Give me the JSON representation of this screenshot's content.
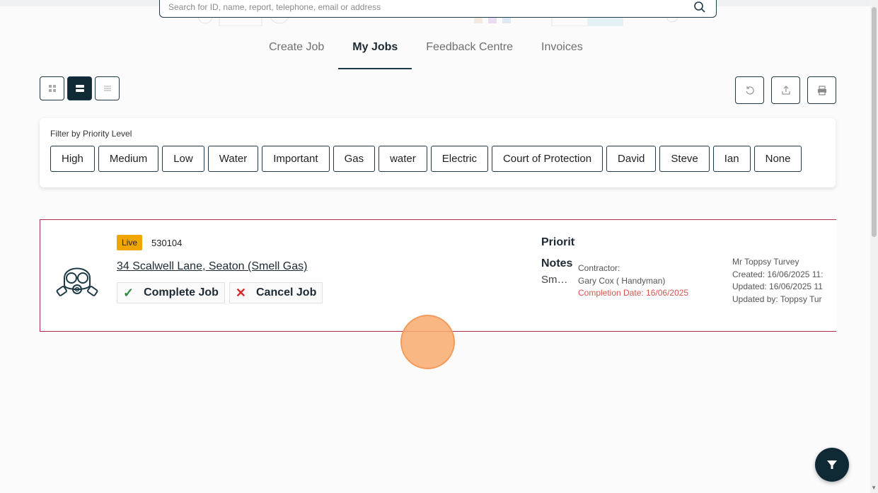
{
  "search": {
    "placeholder": "Search for ID, name, report, telephone, email or address"
  },
  "tabs": [
    {
      "label": "Create Job",
      "active": false
    },
    {
      "label": "My Jobs",
      "active": true
    },
    {
      "label": "Feedback Centre",
      "active": false
    },
    {
      "label": "Invoices",
      "active": false
    }
  ],
  "view_buttons": {
    "grid": "grid-view-icon",
    "card": "card-view-icon",
    "list": "list-view-icon",
    "active": "card"
  },
  "actions": {
    "refresh": "refresh-icon",
    "export": "export-icon",
    "print": "print-icon"
  },
  "filter": {
    "title": "Filter by Priority Level",
    "chips": [
      "High",
      "Medium",
      "Low",
      "Water",
      "Important",
      "Gas",
      "water",
      "Electric",
      "Court of Protection",
      "David",
      "Steve",
      "Ian",
      "None"
    ]
  },
  "job": {
    "status": "Live",
    "id": "530104",
    "address": "34 Scalwell Lane, Seaton (Smell Gas)",
    "complete_label": "Complete Job",
    "cancel_label": "Cancel Job",
    "priority_label": "Priority",
    "notes_label": "Notes",
    "notes_text": "Smell Gas",
    "contractor_label": "Contractor:",
    "contractor_name": "Gary Cox ( Handyman)",
    "completion_date": "Completion Date: 16/06/2025",
    "owner": "Mr Toppsy Turvey",
    "created": "Created: 16/06/2025 11:",
    "updated": "Updated: 16/06/2025 11",
    "updated_by": "Updated by: Toppsy Tur"
  },
  "colors": {
    "primary": "#0f2a35",
    "live": "#f0a500",
    "border_accent": "#b22a4a",
    "completion": "#d9534f"
  }
}
